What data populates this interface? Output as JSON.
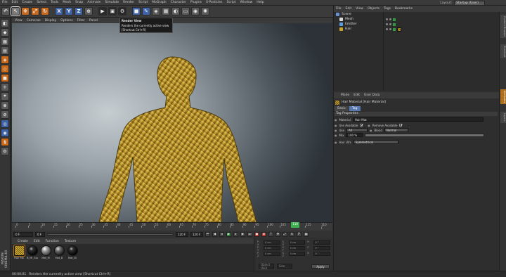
{
  "menu": {
    "items": [
      "File",
      "Edit",
      "Create",
      "Select",
      "Tools",
      "Mesh",
      "Snap",
      "Animate",
      "Simulate",
      "Render",
      "Script",
      "MoGraph",
      "Character",
      "Plugins",
      "X-Particles",
      "Script",
      "Window",
      "Help"
    ],
    "layout_label": "Layout:",
    "layout_value": "Startup (User)"
  },
  "toolbar": {
    "tools": [
      {
        "icon": "undo-icon",
        "glyph": "↶"
      },
      {
        "icon": "select-arrow-icon",
        "glyph": "↖"
      },
      {
        "icon": "move-icon",
        "glyph": "✥"
      },
      {
        "icon": "scale-icon",
        "glyph": "⤢"
      },
      {
        "icon": "rotate-icon",
        "glyph": "↻"
      },
      {
        "icon": "x-axis-icon",
        "glyph": "X"
      },
      {
        "icon": "y-axis-icon",
        "glyph": "Y"
      },
      {
        "icon": "z-axis-icon",
        "glyph": "Z"
      },
      {
        "icon": "coordinate-system-icon",
        "glyph": "⊕"
      },
      {
        "icon": "render-view-icon",
        "glyph": "▶"
      },
      {
        "icon": "render-picture-viewer-icon",
        "glyph": "▣"
      },
      {
        "icon": "render-settings-icon",
        "glyph": "⚙"
      },
      {
        "icon": "cube-icon",
        "glyph": "■"
      },
      {
        "icon": "pen-icon",
        "glyph": "✎"
      },
      {
        "icon": "subdivision-icon",
        "glyph": "◈"
      },
      {
        "icon": "array-icon",
        "glyph": "▦"
      },
      {
        "icon": "deformer-icon",
        "glyph": "◐"
      },
      {
        "icon": "floor-icon",
        "glyph": "▭"
      },
      {
        "icon": "camera-icon",
        "glyph": "◉"
      },
      {
        "icon": "light-icon",
        "glyph": "✺"
      }
    ],
    "right_tools": [
      {
        "icon": "xp-emitter-icon",
        "glyph": "◆"
      },
      {
        "icon": "xp-generator-icon",
        "glyph": "◆"
      },
      {
        "icon": "xp-modifier-icon",
        "glyph": "◆"
      },
      {
        "icon": "xp-question-icon",
        "glyph": "◆"
      },
      {
        "icon": "xp-green-icon",
        "glyph": "◆"
      },
      {
        "icon": "xp-green-icon-2",
        "glyph": "◆"
      },
      {
        "icon": "xp-green-icon-3",
        "glyph": "◆"
      }
    ]
  },
  "tooltip": {
    "title": "Render View",
    "desc": "Renders the currently active view",
    "shortcut": "[Shortcut Ctrl+R]"
  },
  "viewport": {
    "menu": [
      "View",
      "Cameras",
      "Display",
      "Options",
      "Filter",
      "Panel"
    ]
  },
  "timeline": {
    "ticks": [
      "0",
      "5",
      "10",
      "15",
      "20",
      "25",
      "30",
      "35",
      "40",
      "45",
      "50",
      "55",
      "60",
      "65",
      "70",
      "75",
      "80",
      "85",
      "90",
      "95",
      "100",
      "105",
      "110",
      "115"
    ],
    "current_frame": "110",
    "end_marker": "110 F",
    "start_field": "0 F",
    "min_field": "0 F",
    "max_field": "120 F",
    "end_field": "120 F"
  },
  "materials": {
    "menu": [
      "Create",
      "Edit",
      "Function",
      "Texture"
    ],
    "items": [
      {
        "name": "Hair Ma",
        "type": "hair"
      },
      {
        "name": "B_Mi_Glo",
        "type": "black"
      },
      {
        "name": "Mat_M",
        "type": "grey"
      },
      {
        "name": "Mat_B",
        "type": "darkgrey"
      },
      {
        "name": "Mat_Di",
        "type": "black"
      }
    ]
  },
  "coords": {
    "rows": [
      [
        "P . X",
        "0 cm",
        "S . X",
        "0 cm",
        "H",
        "0 °"
      ],
      [
        "P . Y",
        "0 cm",
        "S . Y",
        "0 cm",
        "P",
        "0 °"
      ],
      [
        "P . Z",
        "0 cm",
        "S . Z",
        "0 cm",
        "B",
        "0 °"
      ]
    ],
    "mode_left": "Object (Rel)",
    "mode_right": "Size",
    "apply": "Apply"
  },
  "status": {
    "time": "00:00:01",
    "text": "Renders the currently active view [Shortcut Ctrl+R]"
  },
  "branding": "MAXON CINEMA 4D",
  "objects": {
    "menu": [
      "File",
      "Edit",
      "View",
      "Objects",
      "Tags",
      "Bookmarks"
    ],
    "items": [
      {
        "name": "Scene",
        "indent": 0,
        "color": "#6a8fcf",
        "icon": "layer-icon"
      },
      {
        "name": "Mesh",
        "indent": 1,
        "color": "#d9d9d9",
        "icon": "polygon-icon",
        "tag": false
      },
      {
        "name": "Emitter",
        "indent": 1,
        "color": "#5a9de0",
        "icon": "emitter-icon",
        "tag": false
      },
      {
        "name": "Hair",
        "indent": 1,
        "color": "#c9a42b",
        "icon": "hair-icon",
        "tag": true
      }
    ]
  },
  "attributes": {
    "menu": [
      "Mode",
      "Edit",
      "User Data"
    ],
    "title": "Hair Material [Hair Material]",
    "tabs": [
      "Basic",
      "Tag"
    ],
    "active_tab": "Tag",
    "section": "Tag Properties",
    "material_label": "Material",
    "material_value": "Hair Mat",
    "use_available_label": "Use Available",
    "remove_available_label": "Remove Available",
    "use_label": "Use",
    "use_value": "All",
    "blend_label": "Blend",
    "blend_value": "Normal",
    "mix_label": "Mix",
    "mix_value": "100 %",
    "mix_fraction": 1.0,
    "hair_uvs_label": "Hair UVs",
    "hair_uvs_value": "Symmetrical"
  },
  "sidetabs": {
    "items": [
      "Content Browser",
      "Structure",
      "Attributes",
      "Layers"
    ],
    "active": "Attributes"
  },
  "colors": {
    "accent_blue": "#5779b0",
    "active_orange": "#b0701e",
    "playhead_green": "#3fae4f",
    "gold": "#c9a42b"
  }
}
